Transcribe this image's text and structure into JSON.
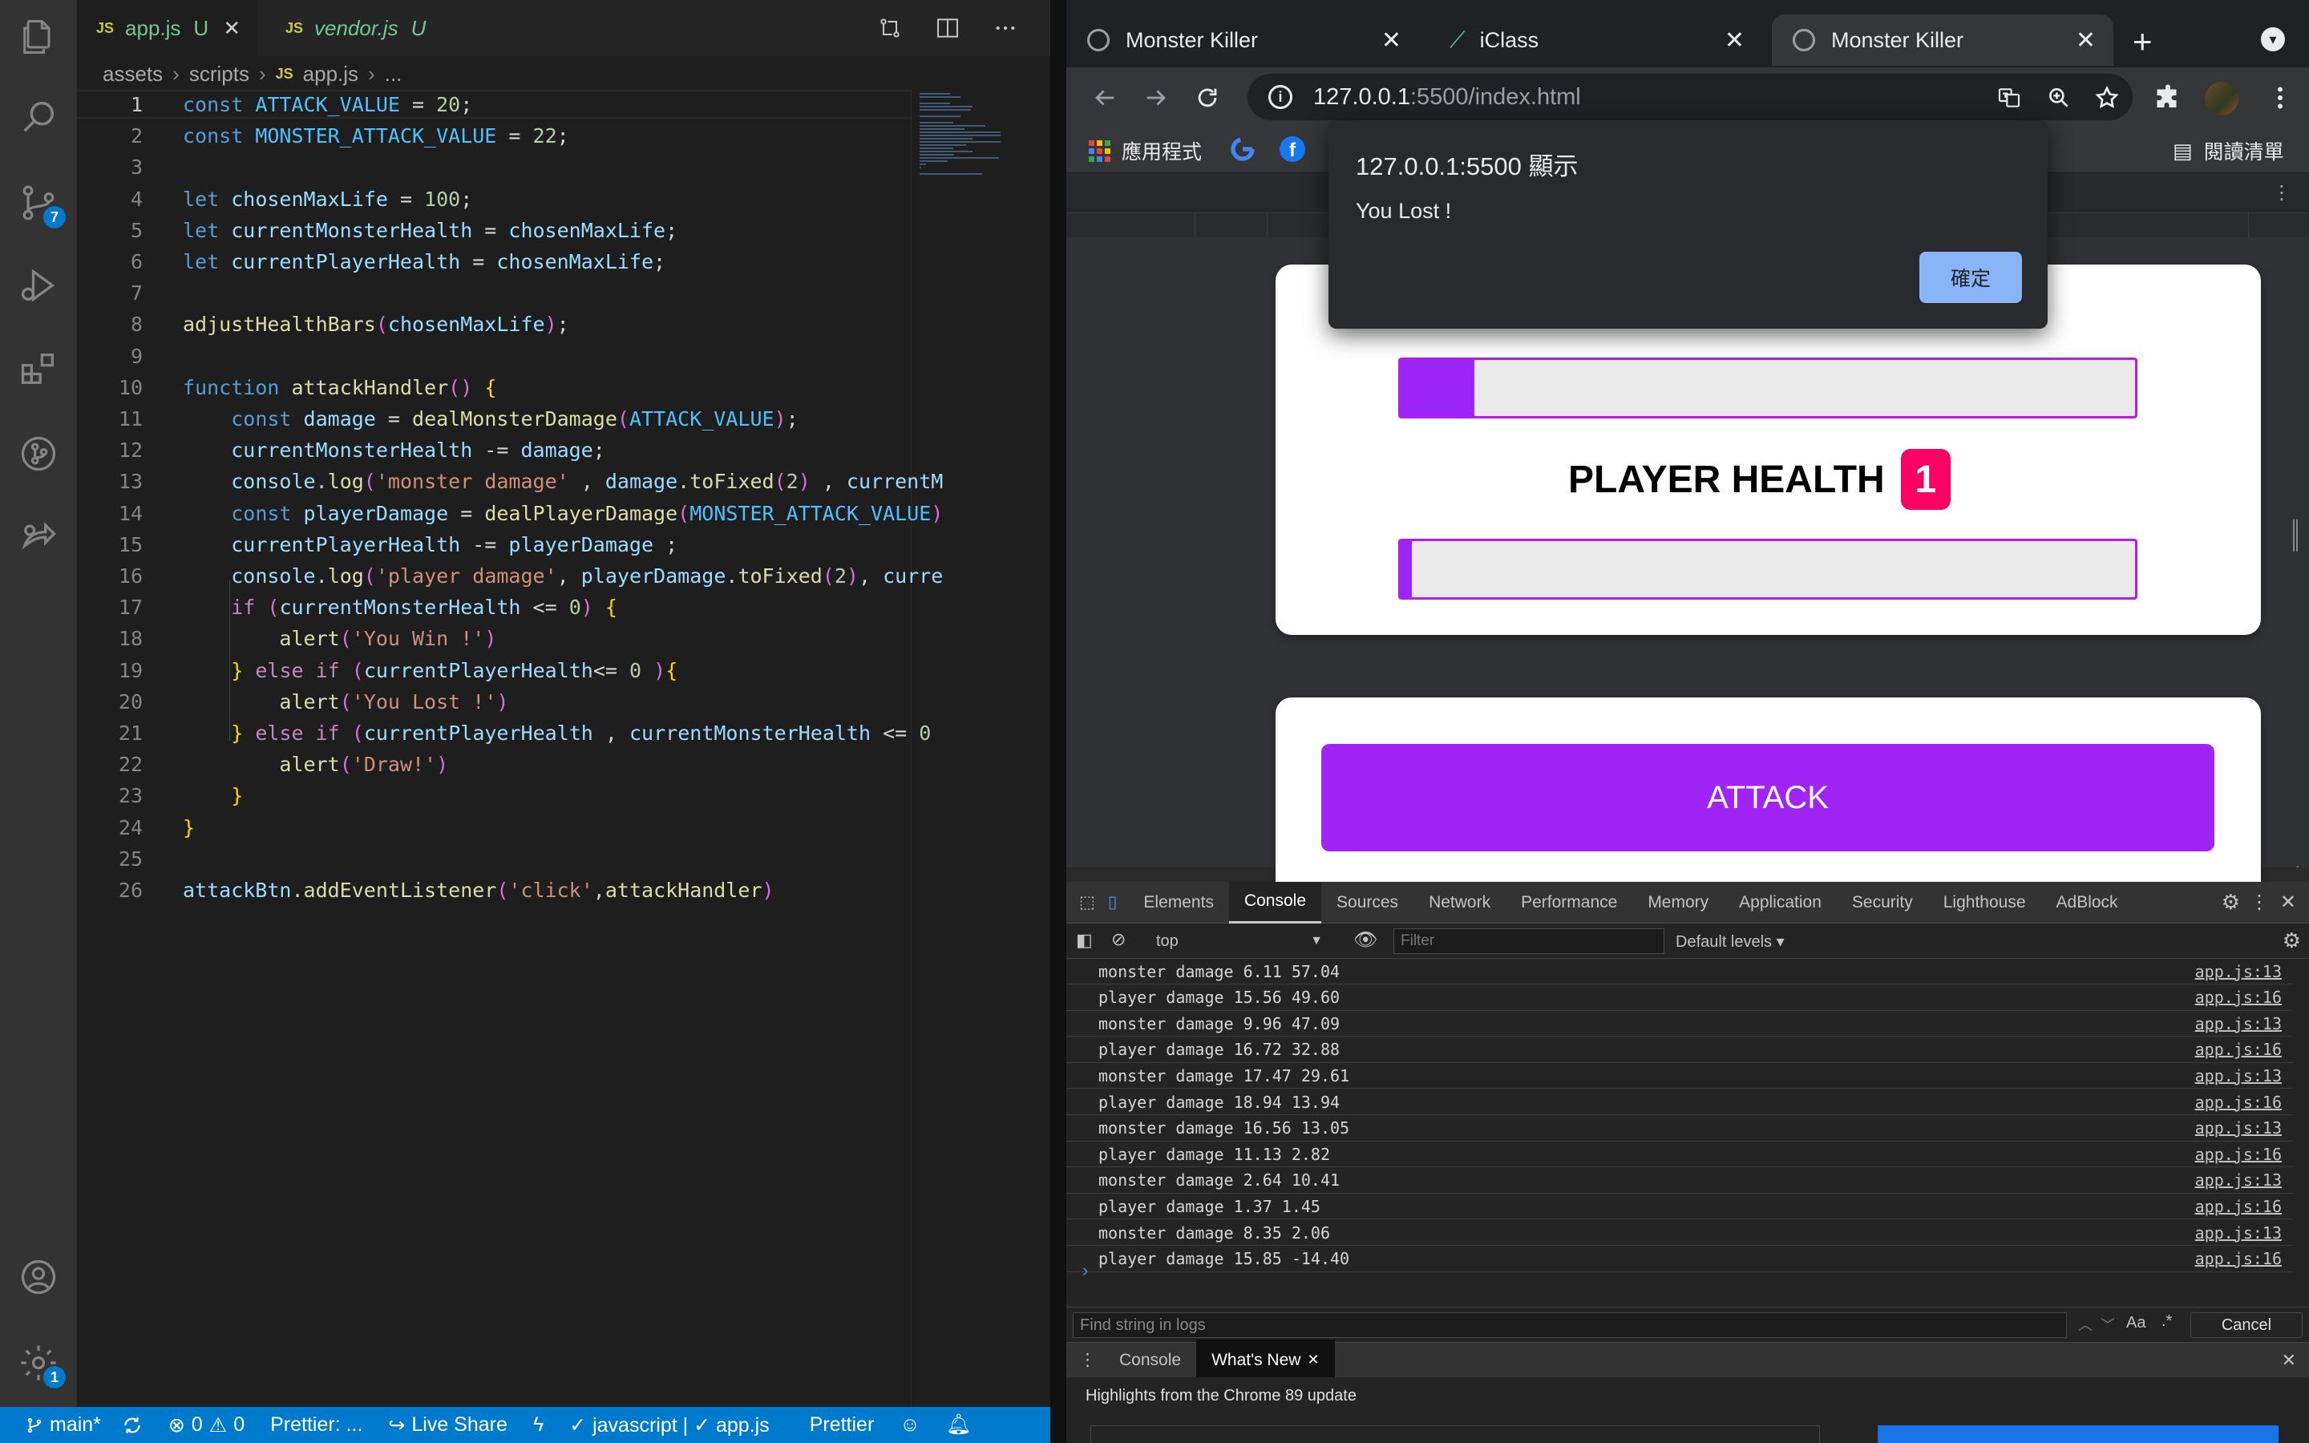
{
  "vscode": {
    "tabs": [
      {
        "icon": "JS",
        "name": "app.js",
        "status": "U",
        "close": "✕"
      },
      {
        "icon": "JS",
        "name": "vendor.js",
        "status": "U"
      }
    ],
    "breadcrumb": [
      "assets",
      "scripts",
      "app.js",
      "..."
    ],
    "breadcrumb_file_icon": "JS",
    "activity_badges": {
      "source_control": "7",
      "settings": "1"
    },
    "line_numbers": [
      "1",
      "2",
      "3",
      "4",
      "5",
      "6",
      "7",
      "8",
      "9",
      "10",
      "11",
      "12",
      "13",
      "14",
      "15",
      "16",
      "17",
      "18",
      "19",
      "20",
      "21",
      "22",
      "23",
      "24",
      "25",
      "26"
    ],
    "code": [
      "const ATTACK_VALUE = 20;",
      "const MONSTER_ATTACK_VALUE = 22;",
      "",
      "let chosenMaxLife = 100;",
      "let currentMonsterHealth = chosenMaxLife;",
      "let currentPlayerHealth = chosenMaxLife;",
      "",
      "adjustHealthBars(chosenMaxLife);",
      "",
      "function attackHandler() {",
      "    const damage = dealMonsterDamage(ATTACK_VALUE);",
      "    currentMonsterHealth -= damage;",
      "    console.log('monster damage' , damage.toFixed(2) , currentM",
      "    const playerDamage = dealPlayerDamage(MONSTER_ATTACK_VALUE)",
      "    currentPlayerHealth -= playerDamage ;",
      "    console.log('player damage', playerDamage.toFixed(2), curre",
      "    if (currentMonsterHealth <= 0) {",
      "        alert('You Win !')",
      "    } else if (currentPlayerHealth<= 0 ){",
      "        alert('You Lost !')",
      "    } else if (currentPlayerHealth , currentMonsterHealth <= 0",
      "        alert('Draw!')",
      "    }",
      "}",
      "",
      "attackBtn.addEventListener('click',attackHandler)"
    ],
    "status": {
      "branch": "main*",
      "errors": "0",
      "warnings": "0",
      "prettier_short": "Prettier: ...",
      "live_share": "Live Share",
      "language": "javascript | ✓ app.js",
      "prettier": "Prettier"
    }
  },
  "chrome": {
    "tabs": [
      {
        "title": "Monster Killer"
      },
      {
        "title": "iClass"
      },
      {
        "title": "Monster Killer"
      }
    ],
    "url_host": "127.0.0.1",
    "url_rest": ":5500/index.html",
    "bookmarks": {
      "apps": "應用程式",
      "reading_list": "閱讀清單"
    },
    "alert": {
      "title": "127.0.0.1:5500 顯示",
      "message": "You Lost !",
      "ok": "確定"
    },
    "page": {
      "player_health_label": "PLAYER HEALTH",
      "player_health_badge": "1",
      "monster_health_fraction": 0.1,
      "player_health_fraction": 0.015,
      "attack_label": "ATTACK"
    },
    "devtools": {
      "tabs": [
        "Elements",
        "Console",
        "Sources",
        "Network",
        "Performance",
        "Memory",
        "Application",
        "Security",
        "Lighthouse",
        "AdBlock"
      ],
      "context": "top",
      "filter_placeholder": "Filter",
      "levels": "Default levels ▾",
      "logs": [
        {
          "msg": "monster damage 6.11 57.04",
          "src": "app.js:13"
        },
        {
          "msg": "player damage 15.56 49.60",
          "src": "app.js:16"
        },
        {
          "msg": "monster damage 9.96 47.09",
          "src": "app.js:13"
        },
        {
          "msg": "player damage 16.72 32.88",
          "src": "app.js:16"
        },
        {
          "msg": "monster damage 17.47 29.61",
          "src": "app.js:13"
        },
        {
          "msg": "player damage 18.94 13.94",
          "src": "app.js:16"
        },
        {
          "msg": "monster damage 16.56 13.05",
          "src": "app.js:13"
        },
        {
          "msg": "player damage 11.13 2.82",
          "src": "app.js:16"
        },
        {
          "msg": "monster damage 2.64 10.41",
          "src": "app.js:13"
        },
        {
          "msg": "player damage 1.37 1.45",
          "src": "app.js:16"
        },
        {
          "msg": "monster damage 8.35 2.06",
          "src": "app.js:13"
        },
        {
          "msg": "player damage 15.85 -14.40",
          "src": "app.js:16"
        }
      ],
      "prompt": "›",
      "find_placeholder": "Find string in logs",
      "find_cancel": "Cancel",
      "drawer_tabs": [
        "Console",
        "What's New"
      ],
      "drawer_heading": "Highlights from the Chrome 89 update"
    }
  }
}
